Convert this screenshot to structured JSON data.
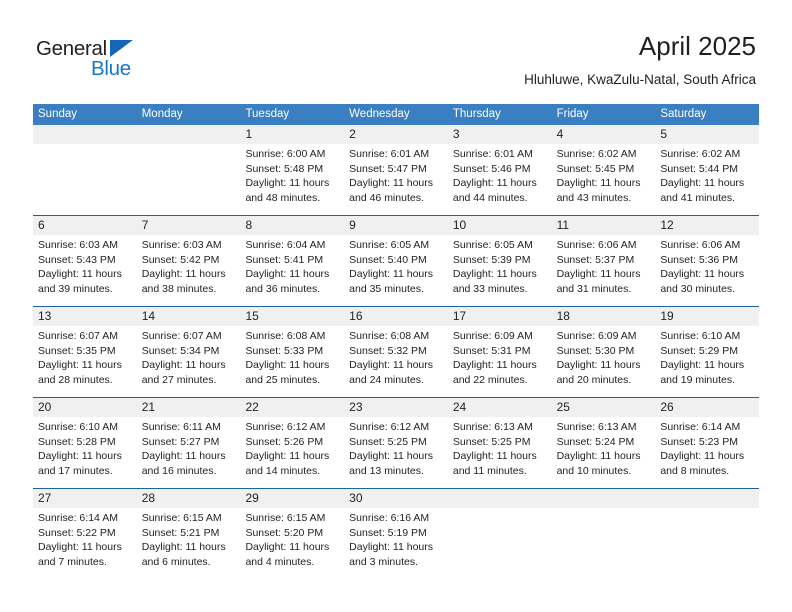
{
  "brand": {
    "general": "General",
    "blue": "Blue",
    "triangle_color": "#1565b8",
    "blue_color": "#1878c8"
  },
  "header": {
    "title": "April 2025",
    "subtitle": "Hluhluwe, KwaZulu-Natal, South Africa"
  },
  "theme": {
    "header_band": "#3a7fc1",
    "row_rule": "#20609f",
    "daynum_band": "#f0f0f0",
    "text": "#231f20"
  },
  "calendar": {
    "weekdays": [
      "Sunday",
      "Monday",
      "Tuesday",
      "Wednesday",
      "Thursday",
      "Friday",
      "Saturday"
    ],
    "weeks": [
      [
        {
          "day": "",
          "lines": [
            "",
            "",
            "",
            ""
          ]
        },
        {
          "day": "",
          "lines": [
            "",
            "",
            "",
            ""
          ]
        },
        {
          "day": "1",
          "lines": [
            "Sunrise: 6:00 AM",
            "Sunset: 5:48 PM",
            "Daylight: 11 hours",
            "and 48 minutes."
          ]
        },
        {
          "day": "2",
          "lines": [
            "Sunrise: 6:01 AM",
            "Sunset: 5:47 PM",
            "Daylight: 11 hours",
            "and 46 minutes."
          ]
        },
        {
          "day": "3",
          "lines": [
            "Sunrise: 6:01 AM",
            "Sunset: 5:46 PM",
            "Daylight: 11 hours",
            "and 44 minutes."
          ]
        },
        {
          "day": "4",
          "lines": [
            "Sunrise: 6:02 AM",
            "Sunset: 5:45 PM",
            "Daylight: 11 hours",
            "and 43 minutes."
          ]
        },
        {
          "day": "5",
          "lines": [
            "Sunrise: 6:02 AM",
            "Sunset: 5:44 PM",
            "Daylight: 11 hours",
            "and 41 minutes."
          ]
        }
      ],
      [
        {
          "day": "6",
          "lines": [
            "Sunrise: 6:03 AM",
            "Sunset: 5:43 PM",
            "Daylight: 11 hours",
            "and 39 minutes."
          ]
        },
        {
          "day": "7",
          "lines": [
            "Sunrise: 6:03 AM",
            "Sunset: 5:42 PM",
            "Daylight: 11 hours",
            "and 38 minutes."
          ]
        },
        {
          "day": "8",
          "lines": [
            "Sunrise: 6:04 AM",
            "Sunset: 5:41 PM",
            "Daylight: 11 hours",
            "and 36 minutes."
          ]
        },
        {
          "day": "9",
          "lines": [
            "Sunrise: 6:05 AM",
            "Sunset: 5:40 PM",
            "Daylight: 11 hours",
            "and 35 minutes."
          ]
        },
        {
          "day": "10",
          "lines": [
            "Sunrise: 6:05 AM",
            "Sunset: 5:39 PM",
            "Daylight: 11 hours",
            "and 33 minutes."
          ]
        },
        {
          "day": "11",
          "lines": [
            "Sunrise: 6:06 AM",
            "Sunset: 5:37 PM",
            "Daylight: 11 hours",
            "and 31 minutes."
          ]
        },
        {
          "day": "12",
          "lines": [
            "Sunrise: 6:06 AM",
            "Sunset: 5:36 PM",
            "Daylight: 11 hours",
            "and 30 minutes."
          ]
        }
      ],
      [
        {
          "day": "13",
          "lines": [
            "Sunrise: 6:07 AM",
            "Sunset: 5:35 PM",
            "Daylight: 11 hours",
            "and 28 minutes."
          ]
        },
        {
          "day": "14",
          "lines": [
            "Sunrise: 6:07 AM",
            "Sunset: 5:34 PM",
            "Daylight: 11 hours",
            "and 27 minutes."
          ]
        },
        {
          "day": "15",
          "lines": [
            "Sunrise: 6:08 AM",
            "Sunset: 5:33 PM",
            "Daylight: 11 hours",
            "and 25 minutes."
          ]
        },
        {
          "day": "16",
          "lines": [
            "Sunrise: 6:08 AM",
            "Sunset: 5:32 PM",
            "Daylight: 11 hours",
            "and 24 minutes."
          ]
        },
        {
          "day": "17",
          "lines": [
            "Sunrise: 6:09 AM",
            "Sunset: 5:31 PM",
            "Daylight: 11 hours",
            "and 22 minutes."
          ]
        },
        {
          "day": "18",
          "lines": [
            "Sunrise: 6:09 AM",
            "Sunset: 5:30 PM",
            "Daylight: 11 hours",
            "and 20 minutes."
          ]
        },
        {
          "day": "19",
          "lines": [
            "Sunrise: 6:10 AM",
            "Sunset: 5:29 PM",
            "Daylight: 11 hours",
            "and 19 minutes."
          ]
        }
      ],
      [
        {
          "day": "20",
          "lines": [
            "Sunrise: 6:10 AM",
            "Sunset: 5:28 PM",
            "Daylight: 11 hours",
            "and 17 minutes."
          ]
        },
        {
          "day": "21",
          "lines": [
            "Sunrise: 6:11 AM",
            "Sunset: 5:27 PM",
            "Daylight: 11 hours",
            "and 16 minutes."
          ]
        },
        {
          "day": "22",
          "lines": [
            "Sunrise: 6:12 AM",
            "Sunset: 5:26 PM",
            "Daylight: 11 hours",
            "and 14 minutes."
          ]
        },
        {
          "day": "23",
          "lines": [
            "Sunrise: 6:12 AM",
            "Sunset: 5:25 PM",
            "Daylight: 11 hours",
            "and 13 minutes."
          ]
        },
        {
          "day": "24",
          "lines": [
            "Sunrise: 6:13 AM",
            "Sunset: 5:25 PM",
            "Daylight: 11 hours",
            "and 11 minutes."
          ]
        },
        {
          "day": "25",
          "lines": [
            "Sunrise: 6:13 AM",
            "Sunset: 5:24 PM",
            "Daylight: 11 hours",
            "and 10 minutes."
          ]
        },
        {
          "day": "26",
          "lines": [
            "Sunrise: 6:14 AM",
            "Sunset: 5:23 PM",
            "Daylight: 11 hours",
            "and 8 minutes."
          ]
        }
      ],
      [
        {
          "day": "27",
          "lines": [
            "Sunrise: 6:14 AM",
            "Sunset: 5:22 PM",
            "Daylight: 11 hours",
            "and 7 minutes."
          ]
        },
        {
          "day": "28",
          "lines": [
            "Sunrise: 6:15 AM",
            "Sunset: 5:21 PM",
            "Daylight: 11 hours",
            "and 6 minutes."
          ]
        },
        {
          "day": "29",
          "lines": [
            "Sunrise: 6:15 AM",
            "Sunset: 5:20 PM",
            "Daylight: 11 hours",
            "and 4 minutes."
          ]
        },
        {
          "day": "30",
          "lines": [
            "Sunrise: 6:16 AM",
            "Sunset: 5:19 PM",
            "Daylight: 11 hours",
            "and 3 minutes."
          ]
        },
        {
          "day": "",
          "lines": [
            "",
            "",
            "",
            ""
          ]
        },
        {
          "day": "",
          "lines": [
            "",
            "",
            "",
            ""
          ]
        },
        {
          "day": "",
          "lines": [
            "",
            "",
            "",
            ""
          ]
        }
      ]
    ]
  }
}
